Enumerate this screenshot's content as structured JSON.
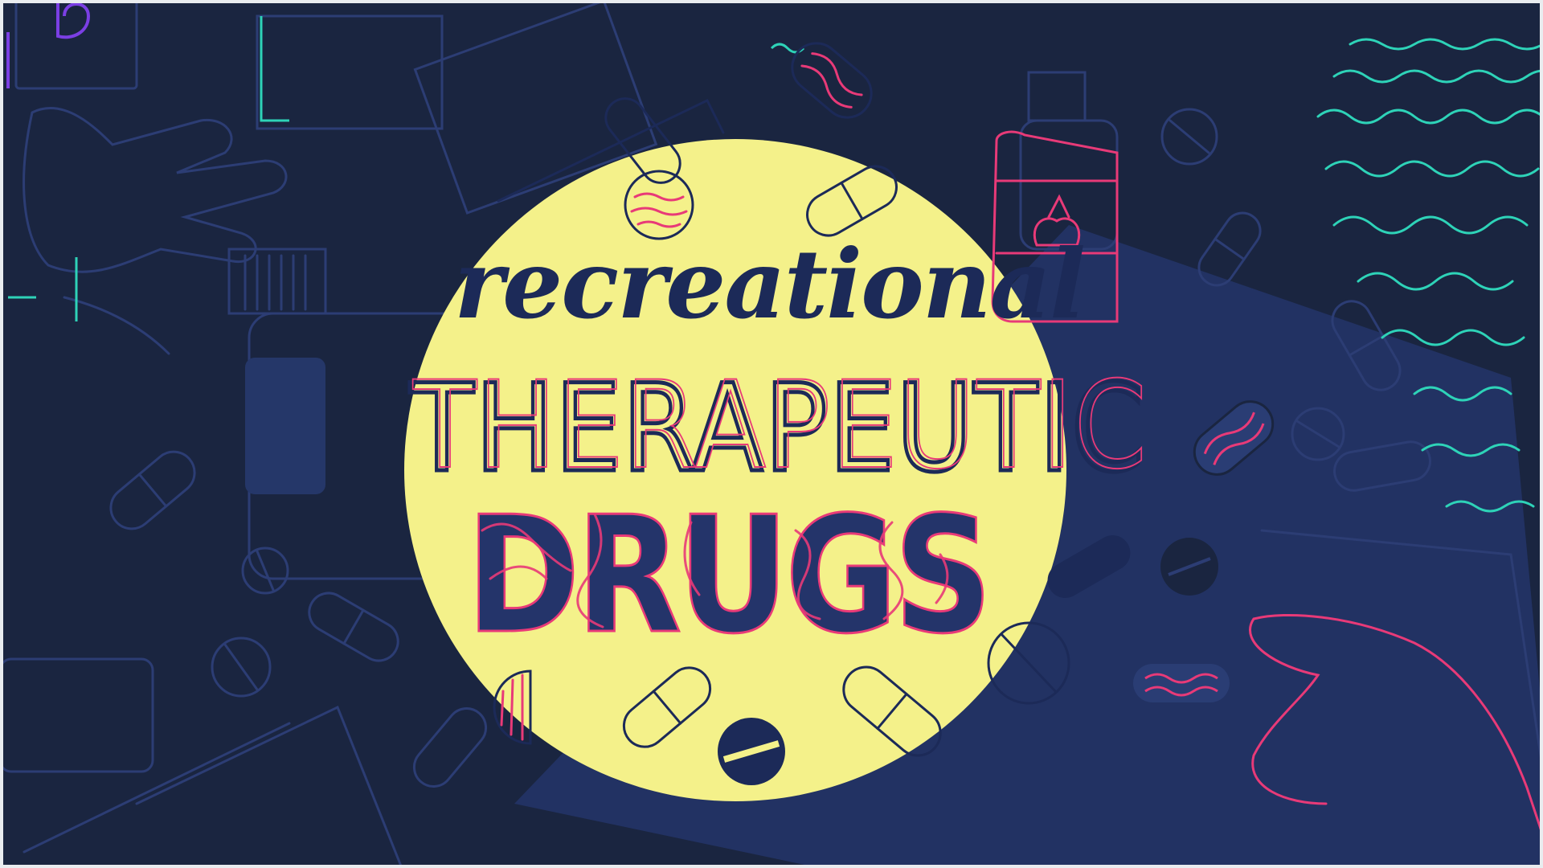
{
  "title": {
    "line1": "recreational",
    "line2": "THERAPEUTIC",
    "line3": "DRUGS"
  },
  "colors": {
    "background": "#1a2540",
    "spotlight": "#f4f18a",
    "beam": "#223263",
    "ink": "#1c2a58",
    "accent_pink": "#e83a78",
    "accent_teal": "#2ed3b8",
    "accent_purple": "#7b3fe4",
    "outline": "#2c3d74"
  },
  "icons": [
    "pill-icon",
    "capsule-icon",
    "tablet-icon",
    "bottle-icon",
    "hand-icon",
    "box-icon",
    "wave-icon"
  ]
}
